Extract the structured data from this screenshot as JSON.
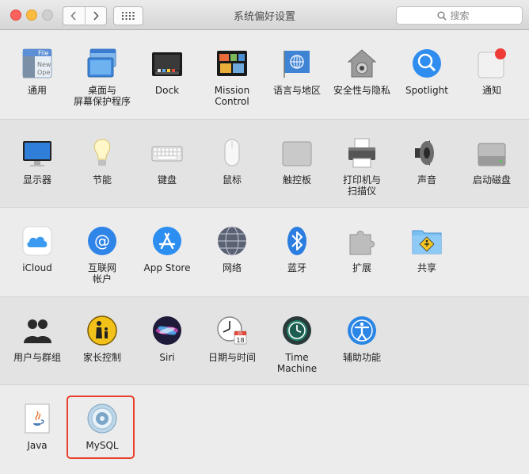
{
  "window": {
    "title": "系统偏好设置"
  },
  "search": {
    "placeholder": "搜索"
  },
  "sections": [
    {
      "panes": [
        {
          "id": "general",
          "label": "通用",
          "icon": "general-icon"
        },
        {
          "id": "desktop",
          "label": "桌面与\n屏幕保护程序",
          "icon": "desktop-screensaver-icon"
        },
        {
          "id": "dock",
          "label": "Dock",
          "icon": "dock-icon"
        },
        {
          "id": "mission",
          "label": "Mission\nControl",
          "icon": "mission-control-icon"
        },
        {
          "id": "language",
          "label": "语言与地区",
          "icon": "language-region-icon"
        },
        {
          "id": "security",
          "label": "安全性与隐私",
          "icon": "security-privacy-icon"
        },
        {
          "id": "spotlight",
          "label": "Spotlight",
          "icon": "spotlight-icon"
        },
        {
          "id": "notifications",
          "label": "通知",
          "icon": "notifications-icon"
        }
      ]
    },
    {
      "panes": [
        {
          "id": "displays",
          "label": "显示器",
          "icon": "displays-icon"
        },
        {
          "id": "energy",
          "label": "节能",
          "icon": "energy-saver-icon"
        },
        {
          "id": "keyboard",
          "label": "键盘",
          "icon": "keyboard-icon"
        },
        {
          "id": "mouse",
          "label": "鼠标",
          "icon": "mouse-icon"
        },
        {
          "id": "trackpad",
          "label": "触控板",
          "icon": "trackpad-icon"
        },
        {
          "id": "printers",
          "label": "打印机与\n扫描仪",
          "icon": "printers-scanners-icon"
        },
        {
          "id": "sound",
          "label": "声音",
          "icon": "sound-icon"
        },
        {
          "id": "startup",
          "label": "启动磁盘",
          "icon": "startup-disk-icon"
        }
      ]
    },
    {
      "panes": [
        {
          "id": "icloud",
          "label": "iCloud",
          "icon": "icloud-icon"
        },
        {
          "id": "internet",
          "label": "互联网\n帐户",
          "icon": "internet-accounts-icon"
        },
        {
          "id": "appstore",
          "label": "App Store",
          "icon": "app-store-icon"
        },
        {
          "id": "network",
          "label": "网络",
          "icon": "network-icon"
        },
        {
          "id": "bluetooth",
          "label": "蓝牙",
          "icon": "bluetooth-icon"
        },
        {
          "id": "extensions",
          "label": "扩展",
          "icon": "extensions-icon"
        },
        {
          "id": "sharing",
          "label": "共享",
          "icon": "sharing-icon"
        }
      ]
    },
    {
      "panes": [
        {
          "id": "users",
          "label": "用户与群组",
          "icon": "users-groups-icon"
        },
        {
          "id": "parental",
          "label": "家长控制",
          "icon": "parental-controls-icon"
        },
        {
          "id": "siri",
          "label": "Siri",
          "icon": "siri-icon"
        },
        {
          "id": "datetime",
          "label": "日期与时间",
          "icon": "date-time-icon"
        },
        {
          "id": "timemachine",
          "label": "Time Machine",
          "icon": "time-machine-icon"
        },
        {
          "id": "accessibility",
          "label": "辅助功能",
          "icon": "accessibility-icon"
        }
      ]
    },
    {
      "panes": [
        {
          "id": "java",
          "label": "Java",
          "icon": "java-icon"
        },
        {
          "id": "mysql",
          "label": "MySQL",
          "icon": "mysql-icon"
        }
      ]
    }
  ],
  "icon_text": {
    "general_file": "File",
    "general_new": "New",
    "general_open": "Ope",
    "calendar_month": "JUL",
    "calendar_day": "18"
  },
  "highlighted_pane": "mysql",
  "colors": {
    "highlight": "#e8402b",
    "accent": "#2f7ff2"
  }
}
